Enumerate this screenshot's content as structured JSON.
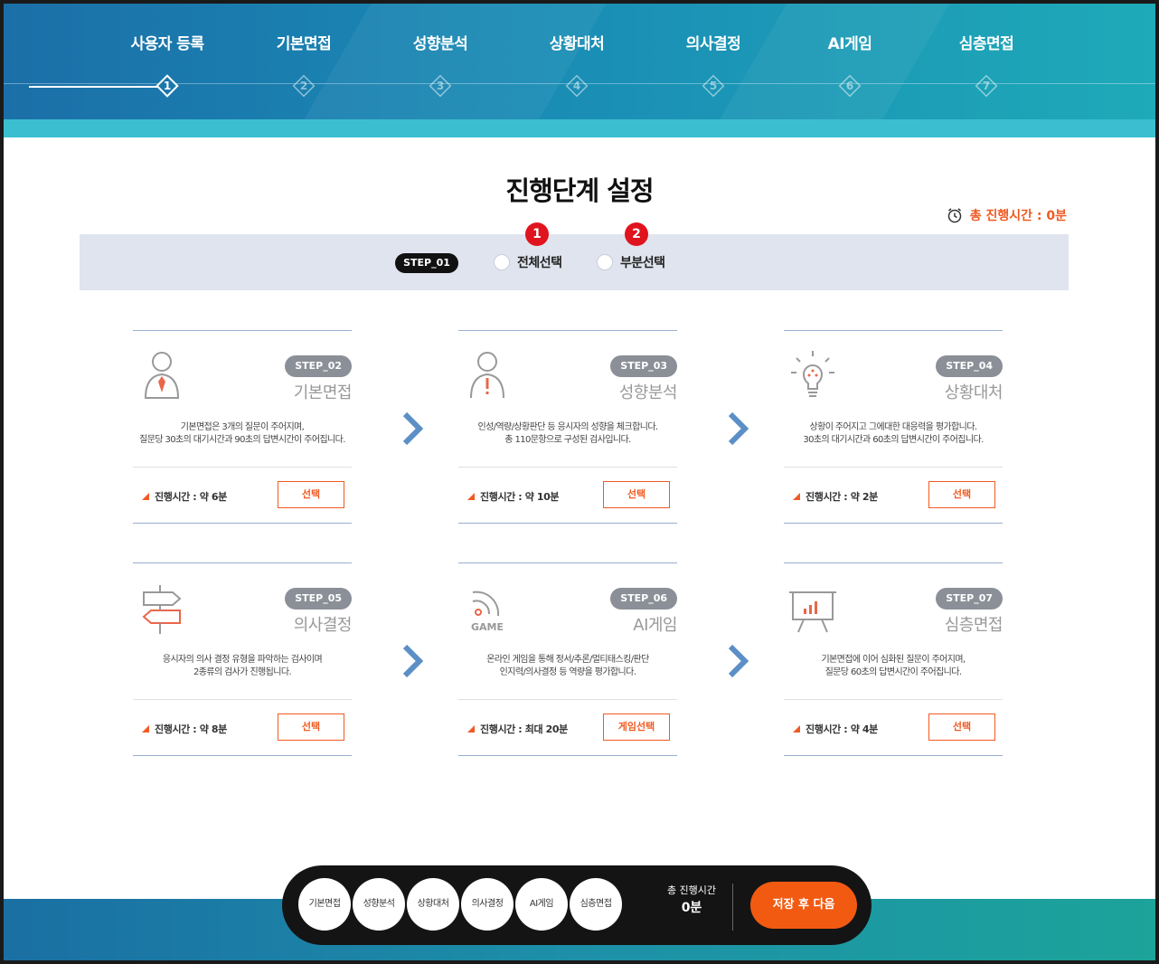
{
  "nav": {
    "steps": [
      {
        "label": "사용자 등록",
        "num": "1"
      },
      {
        "label": "기본면접",
        "num": "2"
      },
      {
        "label": "성향분석",
        "num": "3"
      },
      {
        "label": "상황대처",
        "num": "4"
      },
      {
        "label": "의사결정",
        "num": "5"
      },
      {
        "label": "AI게임",
        "num": "6"
      },
      {
        "label": "심층면접",
        "num": "7"
      }
    ],
    "active_index": 0
  },
  "title": "진행단계 설정",
  "total_time": {
    "label": "총 진행시간 : 0분",
    "icon": "alarm-clock-icon"
  },
  "selection": {
    "step_badge": "STEP_01",
    "options": [
      {
        "label": "전체선택",
        "marker": "1"
      },
      {
        "label": "부분선택",
        "marker": "2"
      }
    ]
  },
  "cards": [
    {
      "badge": "STEP_02",
      "name": "기본면접",
      "icon": "interviewer-icon",
      "desc1": "기본면접은 3개의 질문이 주어지며,",
      "desc2": "질문당 30초의 대기시간과 90초의 답변시간이 주어집니다.",
      "time": "진행시간 : 약 6분",
      "button": "선택"
    },
    {
      "badge": "STEP_03",
      "name": "성향분석",
      "icon": "person-alert-icon",
      "desc1": "인성/역량/상황판단 등 응시자의 성향을 체크합니다.",
      "desc2": "총 110문항으로 구성된 검사입니다.",
      "time": "진행시간 : 약 10분",
      "button": "선택"
    },
    {
      "badge": "STEP_04",
      "name": "상황대처",
      "icon": "lightbulb-icon",
      "desc1": "상황이 주어지고 그에대한 대응력을 평가합니다.",
      "desc2": "30초의 대기시간과 60초의 답변시간이 주어집니다.",
      "time": "진행시간 : 약 2분",
      "button": "선택"
    },
    {
      "badge": "STEP_05",
      "name": "의사결정",
      "icon": "signpost-icon",
      "desc1": "응시자의 의사 결정 유형을 파악하는 검사이며",
      "desc2": "2종류의 검사가 진행됩니다.",
      "time": "진행시간 : 약 8분",
      "button": "선택"
    },
    {
      "badge": "STEP_06",
      "name": "AI게임",
      "icon": "game-signal-icon",
      "icon_text": "GAME",
      "desc1": "온라인 게임을 통해 정서/추론/멀티태스킹/판단",
      "desc2": "인지력/의사결정 등 역량을 평가합니다.",
      "time": "진행시간 : 최대 20분",
      "button": "게임선택"
    },
    {
      "badge": "STEP_07",
      "name": "심층면접",
      "icon": "presentation-chart-icon",
      "desc1": "기본면접에 이어 심화된 질문이 주어지며,",
      "desc2": "질문당 60초의 답변시간이 주어집니다.",
      "time": "진행시간 : 약 4분",
      "button": "선택"
    }
  ],
  "dock": {
    "items": [
      "기본면접",
      "성향분석",
      "상황대처",
      "의사결정",
      "AI게임",
      "심층면접"
    ],
    "total_label": "총 진행시간",
    "total_value": "0분",
    "save_label": "저장 후 다음"
  },
  "colors": {
    "accent": "#f15a22",
    "header_start": "#1b6fa8",
    "header_end": "#1eaab8",
    "marker": "#e0141e",
    "card_line": "#9aaed0"
  }
}
